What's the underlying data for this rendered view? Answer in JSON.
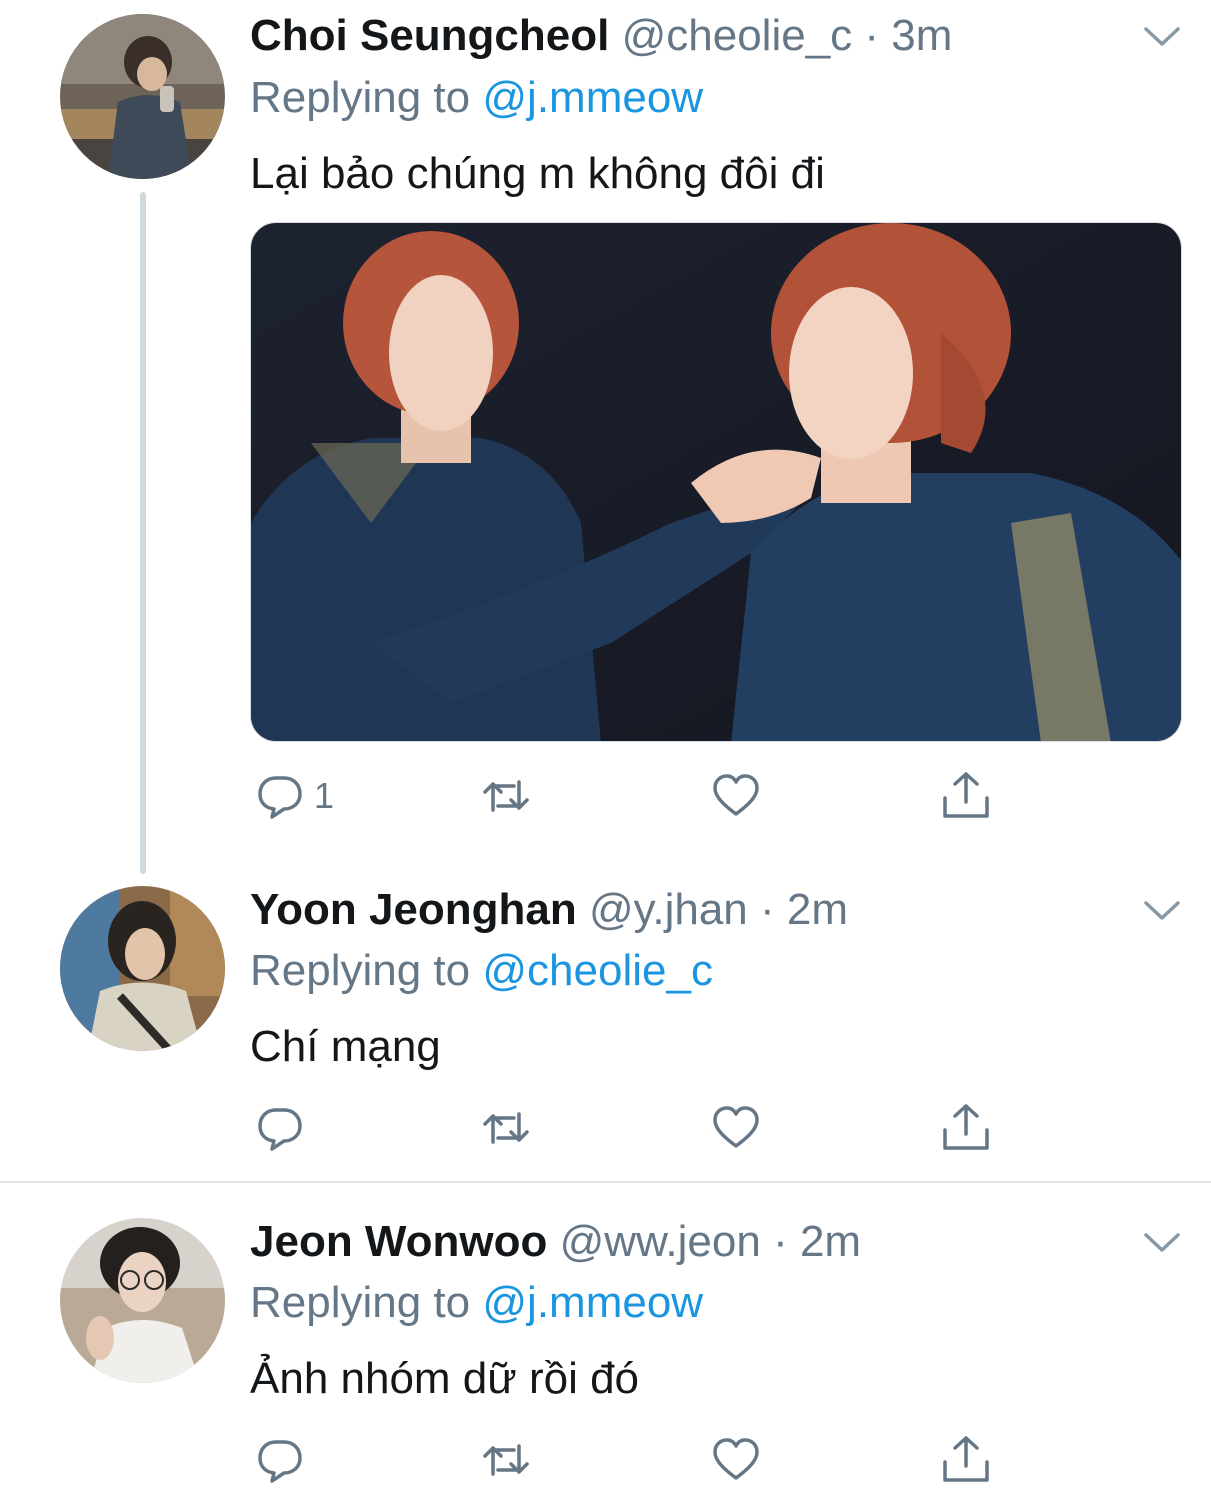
{
  "colors": {
    "text": "#14171a",
    "secondary": "#657786",
    "accent": "#1b95e0",
    "divider": "#e1e8ed"
  },
  "tweets": [
    {
      "name": "Choi Seungcheol",
      "handle": "@cheolie_c",
      "sep": "·",
      "time": "3m",
      "replying_prefix": "Replying to",
      "replying_to": "@j.mmeow",
      "text": "Lại bảo chúng m không đôi đi",
      "reply_count": "1",
      "has_media": true
    },
    {
      "name": "Yoon Jeonghan",
      "handle": "@y.jhan",
      "sep": "·",
      "time": "2m",
      "replying_prefix": "Replying to",
      "replying_to": "@cheolie_c",
      "text": "Chí mạng",
      "reply_count": ""
    },
    {
      "name": "Jeon Wonwoo",
      "handle": "@ww.jeon",
      "sep": "·",
      "time": "2m",
      "replying_prefix": "Replying to",
      "replying_to": "@j.mmeow",
      "text": "Ảnh nhóm dữ rồi đó",
      "reply_count": ""
    }
  ],
  "icons": [
    "reply-icon",
    "retweet-icon",
    "like-icon",
    "share-icon",
    "chevron-down-icon"
  ]
}
